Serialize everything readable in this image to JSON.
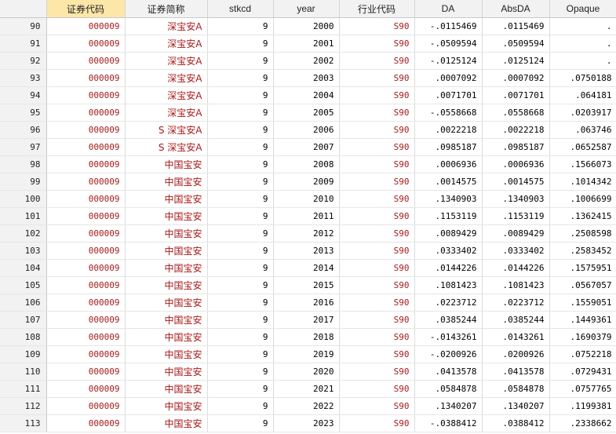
{
  "columns": [
    {
      "key": "row",
      "label": ""
    },
    {
      "key": "code",
      "label": "证券代码"
    },
    {
      "key": "name",
      "label": "证券简称"
    },
    {
      "key": "stkcd",
      "label": "stkcd"
    },
    {
      "key": "year",
      "label": "year"
    },
    {
      "key": "industry",
      "label": "行业代码"
    },
    {
      "key": "da",
      "label": "DA"
    },
    {
      "key": "absda",
      "label": "AbsDA"
    },
    {
      "key": "opaque",
      "label": "Opaque"
    }
  ],
  "selected_column": "code",
  "colors": {
    "header_bg": "#f2f2f2",
    "selected_header_bg": "#fde7a8",
    "string_text": "#a61b1b",
    "grid_line": "#dcdcdc"
  },
  "rows": [
    {
      "row": "90",
      "code": "000009",
      "name": "深宝安A",
      "stkcd": "9",
      "year": "2000",
      "industry": "S90",
      "da": "-.0115469",
      "absda": ".0115469",
      "opaque": "."
    },
    {
      "row": "91",
      "code": "000009",
      "name": "深宝安A",
      "stkcd": "9",
      "year": "2001",
      "industry": "S90",
      "da": "-.0509594",
      "absda": ".0509594",
      "opaque": "."
    },
    {
      "row": "92",
      "code": "000009",
      "name": "深宝安A",
      "stkcd": "9",
      "year": "2002",
      "industry": "S90",
      "da": "-.0125124",
      "absda": ".0125124",
      "opaque": "."
    },
    {
      "row": "93",
      "code": "000009",
      "name": "深宝安A",
      "stkcd": "9",
      "year": "2003",
      "industry": "S90",
      "da": ".0007092",
      "absda": ".0007092",
      "opaque": ".0750188"
    },
    {
      "row": "94",
      "code": "000009",
      "name": "深宝安A",
      "stkcd": "9",
      "year": "2004",
      "industry": "S90",
      "da": ".0071701",
      "absda": ".0071701",
      "opaque": ".064181"
    },
    {
      "row": "95",
      "code": "000009",
      "name": "深宝安A",
      "stkcd": "9",
      "year": "2005",
      "industry": "S90",
      "da": "-.0558668",
      "absda": ".0558668",
      "opaque": ".0203917"
    },
    {
      "row": "96",
      "code": "000009",
      "name": "S 深宝安A",
      "stkcd": "9",
      "year": "2006",
      "industry": "S90",
      "da": ".0022218",
      "absda": ".0022218",
      "opaque": ".063746"
    },
    {
      "row": "97",
      "code": "000009",
      "name": "S 深宝安A",
      "stkcd": "9",
      "year": "2007",
      "industry": "S90",
      "da": ".0985187",
      "absda": ".0985187",
      "opaque": ".0652587"
    },
    {
      "row": "98",
      "code": "000009",
      "name": "中国宝安",
      "stkcd": "9",
      "year": "2008",
      "industry": "S90",
      "da": ".0006936",
      "absda": ".0006936",
      "opaque": ".1566073"
    },
    {
      "row": "99",
      "code": "000009",
      "name": "中国宝安",
      "stkcd": "9",
      "year": "2009",
      "industry": "S90",
      "da": ".0014575",
      "absda": ".0014575",
      "opaque": ".1014342"
    },
    {
      "row": "100",
      "code": "000009",
      "name": "中国宝安",
      "stkcd": "9",
      "year": "2010",
      "industry": "S90",
      "da": ".1340903",
      "absda": ".1340903",
      "opaque": ".1006699"
    },
    {
      "row": "101",
      "code": "000009",
      "name": "中国宝安",
      "stkcd": "9",
      "year": "2011",
      "industry": "S90",
      "da": ".1153119",
      "absda": ".1153119",
      "opaque": ".1362415"
    },
    {
      "row": "102",
      "code": "000009",
      "name": "中国宝安",
      "stkcd": "9",
      "year": "2012",
      "industry": "S90",
      "da": ".0089429",
      "absda": ".0089429",
      "opaque": ".2508598"
    },
    {
      "row": "103",
      "code": "000009",
      "name": "中国宝安",
      "stkcd": "9",
      "year": "2013",
      "industry": "S90",
      "da": ".0333402",
      "absda": ".0333402",
      "opaque": ".2583452"
    },
    {
      "row": "104",
      "code": "000009",
      "name": "中国宝安",
      "stkcd": "9",
      "year": "2014",
      "industry": "S90",
      "da": ".0144226",
      "absda": ".0144226",
      "opaque": ".1575951"
    },
    {
      "row": "105",
      "code": "000009",
      "name": "中国宝安",
      "stkcd": "9",
      "year": "2015",
      "industry": "S90",
      "da": ".1081423",
      "absda": ".1081423",
      "opaque": ".0567057"
    },
    {
      "row": "106",
      "code": "000009",
      "name": "中国宝安",
      "stkcd": "9",
      "year": "2016",
      "industry": "S90",
      "da": ".0223712",
      "absda": ".0223712",
      "opaque": ".1559051"
    },
    {
      "row": "107",
      "code": "000009",
      "name": "中国宝安",
      "stkcd": "9",
      "year": "2017",
      "industry": "S90",
      "da": ".0385244",
      "absda": ".0385244",
      "opaque": ".1449361"
    },
    {
      "row": "108",
      "code": "000009",
      "name": "中国宝安",
      "stkcd": "9",
      "year": "2018",
      "industry": "S90",
      "da": "-.0143261",
      "absda": ".0143261",
      "opaque": ".1690379"
    },
    {
      "row": "109",
      "code": "000009",
      "name": "中国宝安",
      "stkcd": "9",
      "year": "2019",
      "industry": "S90",
      "da": "-.0200926",
      "absda": ".0200926",
      "opaque": ".0752218"
    },
    {
      "row": "110",
      "code": "000009",
      "name": "中国宝安",
      "stkcd": "9",
      "year": "2020",
      "industry": "S90",
      "da": ".0413578",
      "absda": ".0413578",
      "opaque": ".0729431"
    },
    {
      "row": "111",
      "code": "000009",
      "name": "中国宝安",
      "stkcd": "9",
      "year": "2021",
      "industry": "S90",
      "da": ".0584878",
      "absda": ".0584878",
      "opaque": ".0757765"
    },
    {
      "row": "112",
      "code": "000009",
      "name": "中国宝安",
      "stkcd": "9",
      "year": "2022",
      "industry": "S90",
      "da": ".1340207",
      "absda": ".1340207",
      "opaque": ".1199381"
    },
    {
      "row": "113",
      "code": "000009",
      "name": "中国宝安",
      "stkcd": "9",
      "year": "2023",
      "industry": "S90",
      "da": "-.0388412",
      "absda": ".0388412",
      "opaque": ".2338662"
    }
  ]
}
